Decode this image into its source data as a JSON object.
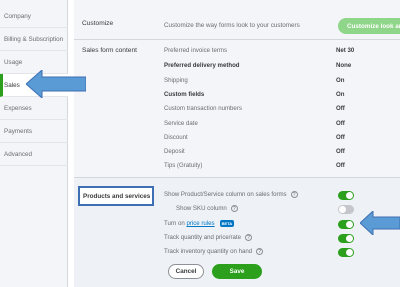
{
  "sidebar": {
    "items": [
      {
        "label": "Company"
      },
      {
        "label": "Billing & Subscription"
      },
      {
        "label": "Usage"
      },
      {
        "label": "Sales",
        "active": true
      },
      {
        "label": "Expenses"
      },
      {
        "label": "Payments"
      },
      {
        "label": "Advanced"
      }
    ]
  },
  "customize": {
    "title": "Customize",
    "description": "Customize the way forms look to your customers",
    "button_label": "Customize look and"
  },
  "sales_form": {
    "title": "Sales form content",
    "rows": [
      {
        "label": "Preferred invoice terms",
        "value": "Net 30",
        "bold": false
      },
      {
        "label": "Preferred delivery method",
        "value": "None",
        "bold": true
      },
      {
        "label": "Shipping",
        "value": "On",
        "bold": false
      },
      {
        "label": "Custom fields",
        "value": "On",
        "bold": true
      },
      {
        "label": "Custom transaction numbers",
        "value": "Off",
        "bold": false
      },
      {
        "label": "Service date",
        "value": "Off",
        "bold": false
      },
      {
        "label": "Discount",
        "value": "Off",
        "bold": false
      },
      {
        "label": "Deposit",
        "value": "Off",
        "bold": false
      },
      {
        "label": "Tips (Gratuity)",
        "value": "Off",
        "bold": false
      }
    ]
  },
  "products": {
    "title": "Products and services",
    "rows": [
      {
        "label": "Show Product/Service column on sales forms",
        "help": "?",
        "enabled": true
      },
      {
        "label": "Show SKU column",
        "help": "?",
        "enabled": false
      },
      {
        "label_prefix": "Turn on",
        "link": "price rules",
        "badge": "BETA",
        "enabled": true
      },
      {
        "label": "Track quantity and price/rate",
        "help": "?",
        "enabled": true
      },
      {
        "label": "Track inventory quantity on hand",
        "help": "?",
        "enabled": true
      }
    ],
    "cancel_label": "Cancel",
    "save_label": "Save"
  },
  "colors": {
    "accent": "#2ca01c",
    "link": "#0077c5",
    "annotation": "#3d6fb3",
    "annotation_fill": "#5b9bd5"
  }
}
